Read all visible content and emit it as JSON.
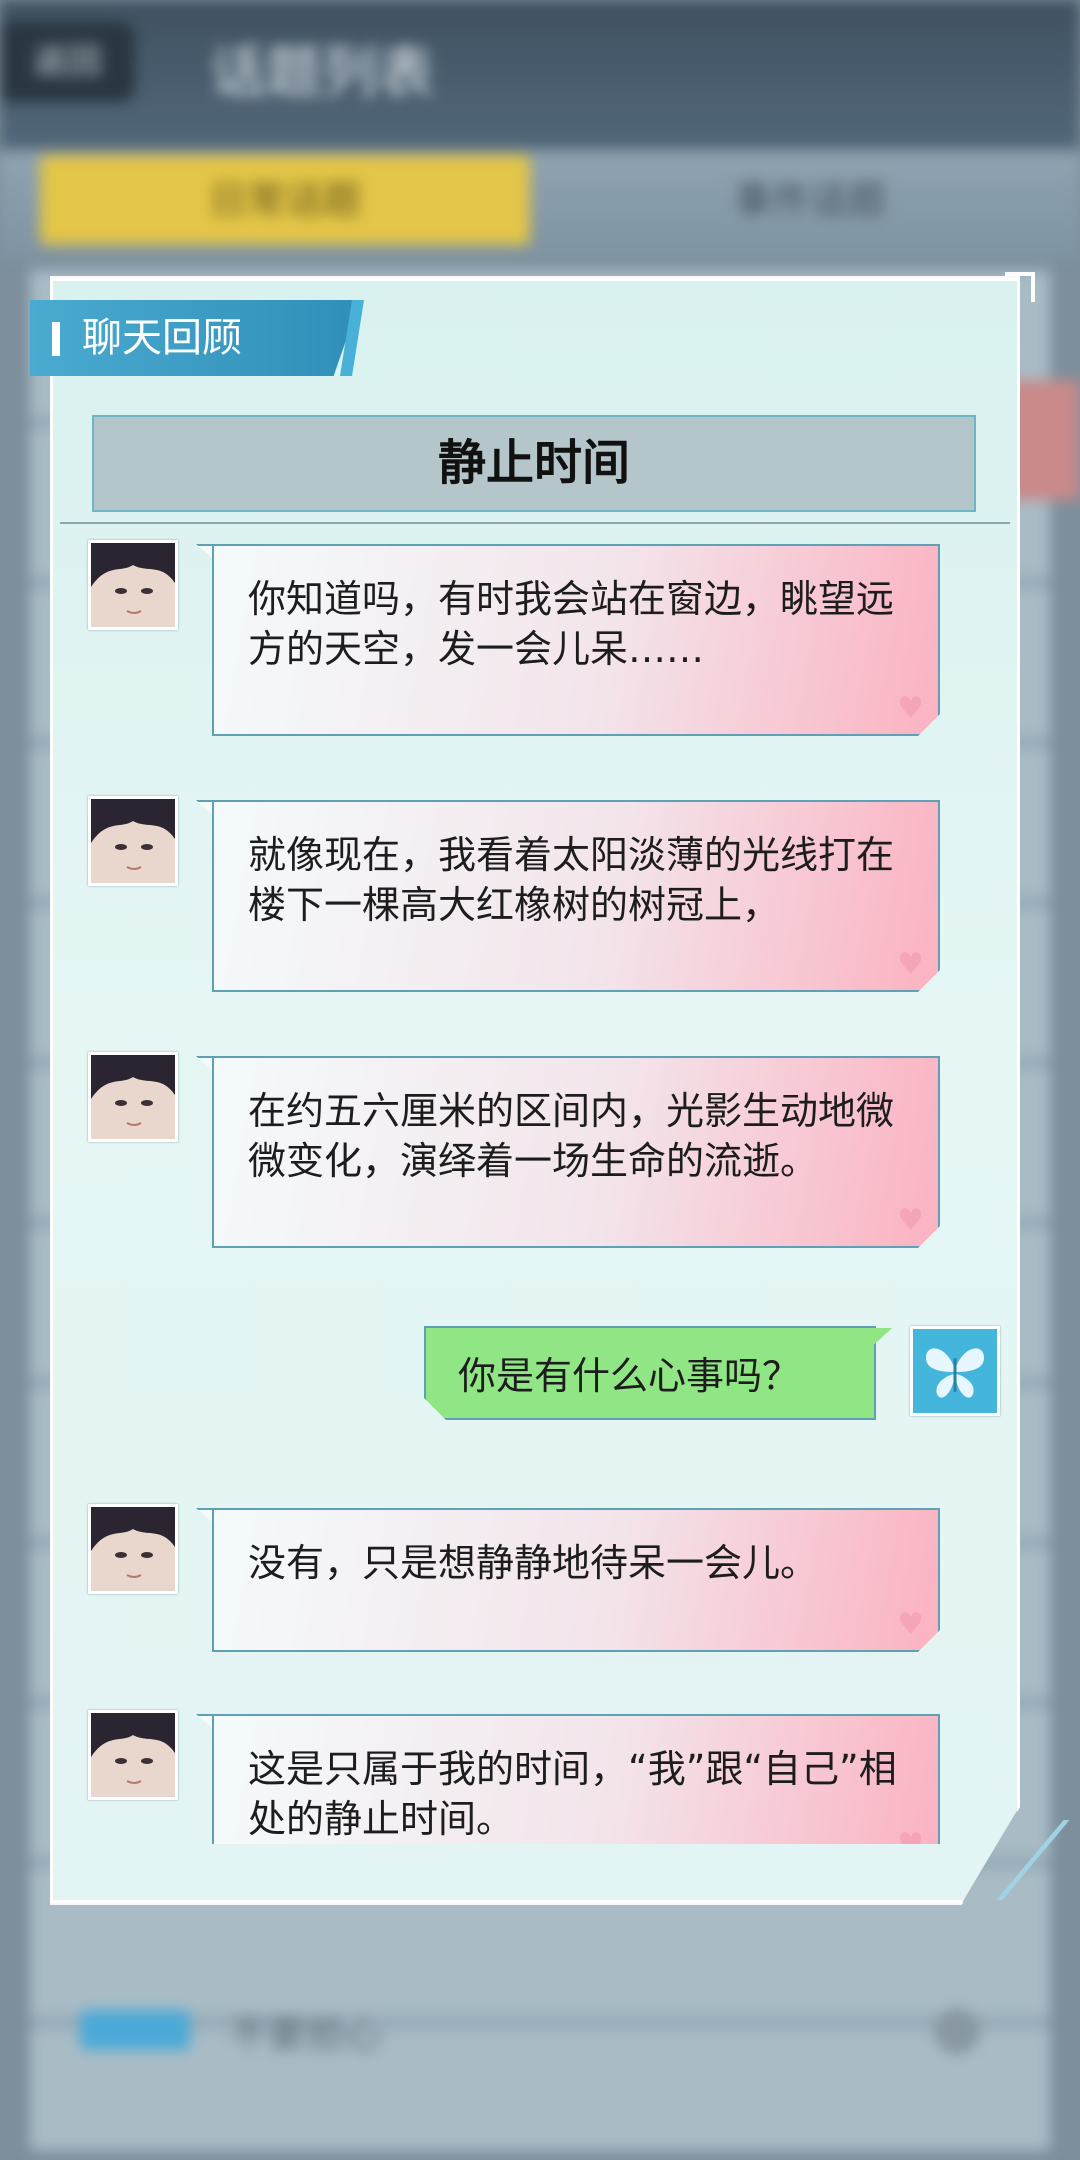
{
  "background": {
    "back_label": "返回",
    "title": "话题列表",
    "tab_active": "日常话题",
    "tab_inactive": "事件话题",
    "rows": [
      "",
      "",
      "",
      "",
      "",
      "",
      "",
      "",
      "",
      "",
      "",
      "",
      ""
    ],
    "bottom_row_label": "不要担心"
  },
  "dialog": {
    "header": "聊天回顾",
    "title": "静止时间"
  },
  "messages": [
    {
      "sender": "npc",
      "text": "你知道吗，有时我会站在窗边，眺望远方的天空，发一会儿呆……"
    },
    {
      "sender": "npc",
      "text": "就像现在，我看着太阳淡薄的光线打在楼下一棵高大红橡树的树冠上，"
    },
    {
      "sender": "npc",
      "text": "在约五六厘米的区间内，光影生动地微微变化，演绎着一场生命的流逝。"
    },
    {
      "sender": "me",
      "text": "你是有什么心事吗？"
    },
    {
      "sender": "npc",
      "text": "没有，只是想静静地待呆一会儿。"
    },
    {
      "sender": "npc",
      "text": "这是只属于我的时间，“我”跟“自己”相处的静止时间。"
    }
  ],
  "icons": {
    "heart": "heart-icon",
    "player_avatar": "butterfly-icon",
    "npc_avatar": "character-portrait"
  },
  "colors": {
    "dialog_bg": "#e3f4f4",
    "header_tab": "#3a9cc5",
    "npc_bubble_end": "#fbb2c1",
    "me_bubble": "#90e585",
    "active_tab": "#e3c547"
  }
}
